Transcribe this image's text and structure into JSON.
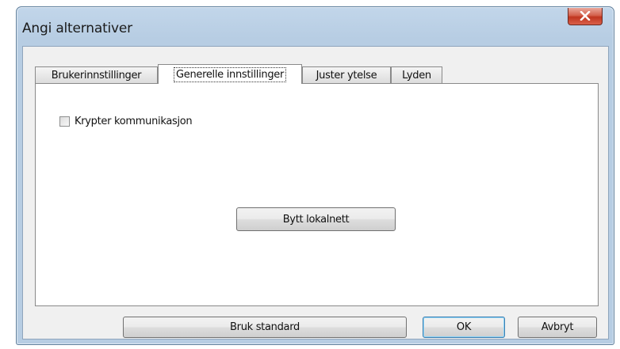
{
  "window": {
    "title": "Angi alternativer"
  },
  "tabs": [
    {
      "label": "Brukerinnstillinger",
      "active": false
    },
    {
      "label": "Generelle innstillinger",
      "active": true
    },
    {
      "label": "Juster ytelse",
      "active": false
    },
    {
      "label": "Lyden",
      "active": false
    }
  ],
  "panel": {
    "encrypt_checkbox": {
      "label": "Krypter kommunikasjon",
      "checked": false
    },
    "change_lan_button": "Bytt lokalnett"
  },
  "footer": {
    "defaults_button": "Bruk standard",
    "ok_button": "OK",
    "cancel_button": "Avbryt"
  },
  "colors": {
    "frame": "#b7cde3",
    "close_button": "#c0351f",
    "default_button_border": "#3c7fb1"
  },
  "icons": {
    "close": "close-icon"
  }
}
